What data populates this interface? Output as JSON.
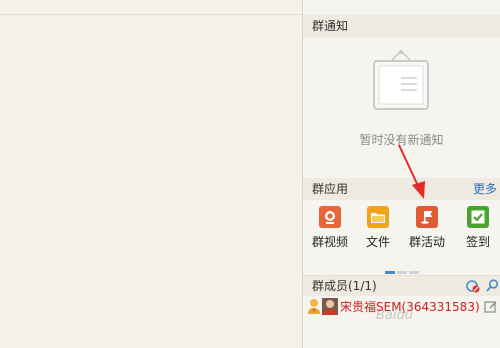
{
  "notice": {
    "title": "群通知",
    "empty_text": "暂时没有新通知"
  },
  "apps": {
    "title": "群应用",
    "more": "更多",
    "items": [
      {
        "label": "群视频",
        "icon": "video-camera-icon",
        "color": "#e8663a"
      },
      {
        "label": "文件",
        "icon": "folder-icon",
        "color": "#f3a21a"
      },
      {
        "label": "群活动",
        "icon": "flag-icon",
        "color": "#e05a35"
      },
      {
        "label": "签到",
        "icon": "checkmark-icon",
        "color": "#47a42e"
      }
    ]
  },
  "members": {
    "title": "群成员(1/1)",
    "list": [
      {
        "name": "宋贵福SEM(364331583)"
      }
    ]
  },
  "watermark": "Baidu"
}
